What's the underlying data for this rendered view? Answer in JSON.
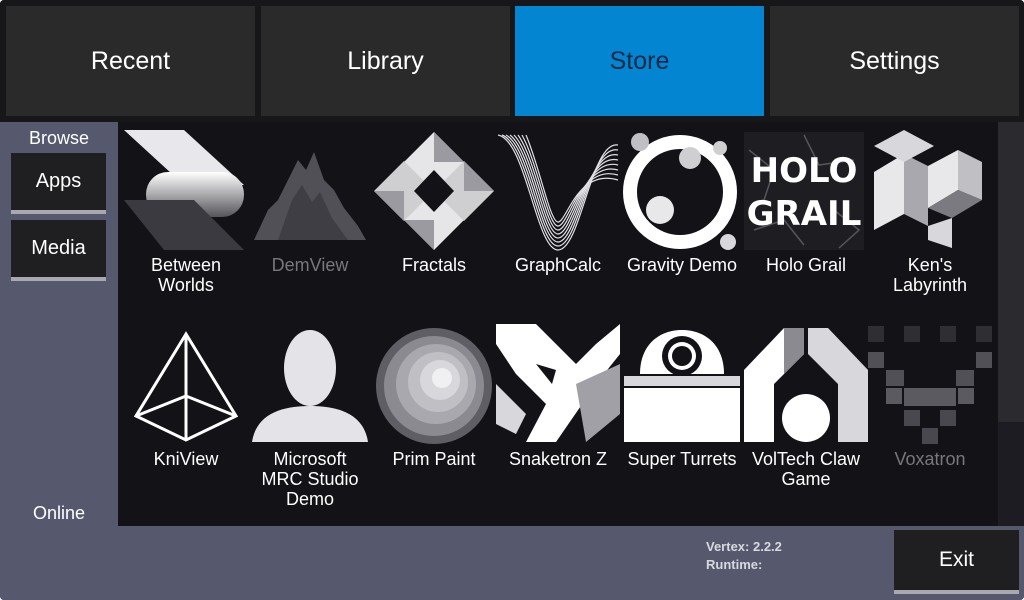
{
  "tabs": [
    {
      "label": "Recent",
      "active": false
    },
    {
      "label": "Library",
      "active": false
    },
    {
      "label": "Store",
      "active": true
    },
    {
      "label": "Settings",
      "active": false
    }
  ],
  "sidebar": {
    "browse_label": "Browse",
    "buttons": [
      {
        "label": "Apps"
      },
      {
        "label": "Media"
      }
    ],
    "online_label": "Online"
  },
  "apps": [
    {
      "name": "Between\nWorlds",
      "icon": "between-worlds-icon",
      "dimmed": false
    },
    {
      "name": "DemView",
      "icon": "demview-icon",
      "dimmed": true
    },
    {
      "name": "Fractals",
      "icon": "fractals-icon",
      "dimmed": false
    },
    {
      "name": "GraphCalc",
      "icon": "graphcalc-icon",
      "dimmed": false
    },
    {
      "name": "Gravity Demo",
      "icon": "gravity-demo-icon",
      "dimmed": false
    },
    {
      "name": "Holo Grail",
      "icon": "holo-grail-icon",
      "dimmed": false,
      "logo_text": [
        "HOLO",
        "GRAIL"
      ]
    },
    {
      "name": "Ken's\nLabyrinth",
      "icon": "kens-labyrinth-icon",
      "dimmed": false
    },
    {
      "name": "KniView",
      "icon": "kniview-icon",
      "dimmed": false
    },
    {
      "name": "Microsoft\nMRC Studio\nDemo",
      "icon": "mrc-studio-icon",
      "dimmed": false
    },
    {
      "name": "Prim Paint",
      "icon": "prim-paint-icon",
      "dimmed": false
    },
    {
      "name": "Snaketron Z",
      "icon": "snaketron-icon",
      "dimmed": false
    },
    {
      "name": "Super Turrets",
      "icon": "super-turrets-icon",
      "dimmed": false
    },
    {
      "name": "VolTech Claw\nGame",
      "icon": "voltech-claw-icon",
      "dimmed": false
    },
    {
      "name": "Voxatron",
      "icon": "voxatron-icon",
      "dimmed": true
    }
  ],
  "footer": {
    "vertex_label": "Vertex: 2.2.2",
    "runtime_label": "Runtime:",
    "exit_label": "Exit"
  },
  "colors": {
    "active_tab": "#0485d1",
    "sidebar": "#56596d",
    "grid_bg": "#121217"
  }
}
